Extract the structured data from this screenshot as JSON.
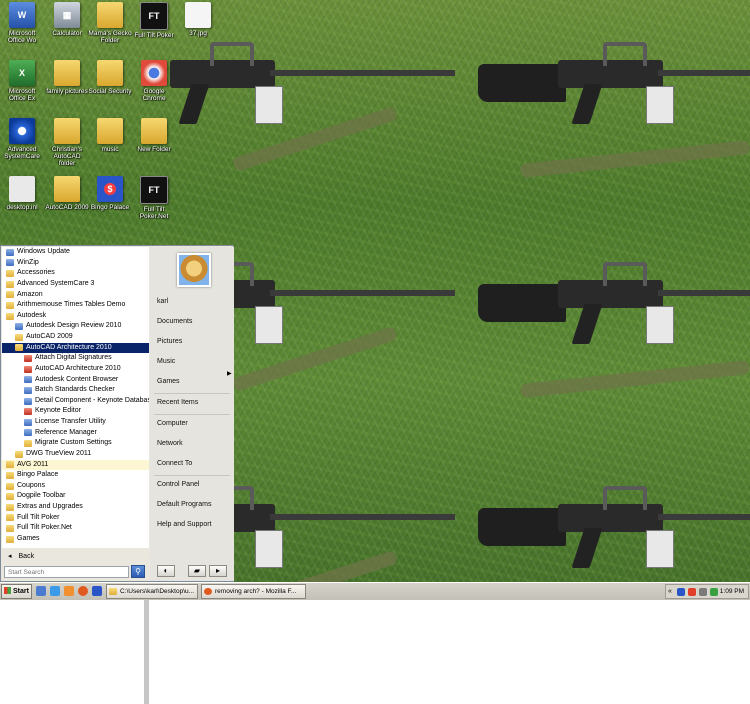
{
  "desktop": {
    "icons": [
      {
        "label": "Microsoft Office Wo",
        "glyph": "W",
        "kind": "word"
      },
      {
        "label": "Calculator",
        "glyph": "▦",
        "kind": "calc"
      },
      {
        "label": "Mama's Gecko Folder",
        "glyph": "",
        "kind": "folder"
      },
      {
        "label": "Full Tilt Poker",
        "glyph": "FT",
        "kind": "ft"
      },
      {
        "label": "37.jpg",
        "glyph": "",
        "kind": "white"
      },
      {
        "label": "Microsoft Office Ex",
        "glyph": "X",
        "kind": "excel"
      },
      {
        "label": "family pictures",
        "glyph": "",
        "kind": "folder"
      },
      {
        "label": "Social Security",
        "glyph": "",
        "kind": "folder"
      },
      {
        "label": "Google Chrome",
        "glyph": "",
        "kind": "chrome"
      },
      {
        "label": "Advanced SystemCare",
        "glyph": "C",
        "kind": "asc"
      },
      {
        "label": "Christian's AutoCAD folder",
        "glyph": "",
        "kind": "folder"
      },
      {
        "label": "music",
        "glyph": "",
        "kind": "folder"
      },
      {
        "label": "New Folder",
        "glyph": "",
        "kind": "folder"
      },
      {
        "label": "desktop.ini",
        "glyph": "",
        "kind": "ini"
      },
      {
        "label": "AutoCAD 2009",
        "glyph": "",
        "kind": "folder"
      },
      {
        "label": "Bingo Palace",
        "glyph": "$",
        "kind": "bingo"
      },
      {
        "label": "Full Tilt Poker.Net",
        "glyph": "FT",
        "kind": "ft"
      }
    ]
  },
  "start_menu": {
    "programs": [
      {
        "label": "Windows Update",
        "icon": "app",
        "indent": 0
      },
      {
        "label": "WinZip",
        "icon": "app",
        "indent": 0
      },
      {
        "label": "Accessories",
        "icon": "folder",
        "indent": 0
      },
      {
        "label": "Advanced SystemCare 3",
        "icon": "folder",
        "indent": 0
      },
      {
        "label": "Amazon",
        "icon": "folder",
        "indent": 0
      },
      {
        "label": "Arithmemouse Times Tables Demo",
        "icon": "folder",
        "indent": 0
      },
      {
        "label": "Autodesk",
        "icon": "folder",
        "indent": 0
      },
      {
        "label": "Autodesk Design Review 2010",
        "icon": "app",
        "indent": 1
      },
      {
        "label": "AutoCAD 2009",
        "icon": "folder",
        "indent": 1
      },
      {
        "label": "AutoCAD Architecture 2010",
        "icon": "folder",
        "indent": 1,
        "state": "selected"
      },
      {
        "label": "Attach Digital Signatures",
        "icon": "red",
        "indent": 2
      },
      {
        "label": "AutoCAD Architecture 2010",
        "icon": "red",
        "indent": 2
      },
      {
        "label": "Autodesk Content Browser",
        "icon": "app",
        "indent": 2
      },
      {
        "label": "Batch Standards Checker",
        "icon": "app",
        "indent": 2
      },
      {
        "label": "Detail Component - Keynote Database",
        "icon": "app",
        "indent": 2
      },
      {
        "label": "Keynote Editor",
        "icon": "red",
        "indent": 2
      },
      {
        "label": "License Transfer Utility",
        "icon": "app",
        "indent": 2
      },
      {
        "label": "Reference Manager",
        "icon": "app",
        "indent": 2
      },
      {
        "label": "Migrate Custom Settings",
        "icon": "folder",
        "indent": 2
      },
      {
        "label": "DWG TrueView 2011",
        "icon": "folder",
        "indent": 1
      },
      {
        "label": "AVG 2011",
        "icon": "folder",
        "indent": 0,
        "state": "highlight"
      },
      {
        "label": "Bingo Palace",
        "icon": "folder",
        "indent": 0
      },
      {
        "label": "Coupons",
        "icon": "folder",
        "indent": 0
      },
      {
        "label": "Dogpile Toolbar",
        "icon": "folder",
        "indent": 0
      },
      {
        "label": "Extras and Upgrades",
        "icon": "folder",
        "indent": 0
      },
      {
        "label": "Full Tilt Poker",
        "icon": "folder",
        "indent": 0
      },
      {
        "label": "Full Tilt Poker.Net",
        "icon": "folder",
        "indent": 0
      },
      {
        "label": "Games",
        "icon": "folder",
        "indent": 0
      }
    ],
    "back_label": "Back",
    "search_placeholder": "Start Search",
    "right_items": [
      {
        "label": "karl",
        "group": 1
      },
      {
        "label": "Documents",
        "group": 1
      },
      {
        "label": "Pictures",
        "group": 1
      },
      {
        "label": "Music",
        "group": 1
      },
      {
        "label": "Games",
        "group": 1
      },
      {
        "label": "Recent Items",
        "group": 2,
        "submenu": true
      },
      {
        "label": "Computer",
        "group": 3
      },
      {
        "label": "Network",
        "group": 3
      },
      {
        "label": "Connect To",
        "group": 3
      },
      {
        "label": "Control Panel",
        "group": 4
      },
      {
        "label": "Default Programs",
        "group": 4
      },
      {
        "label": "Help and Support",
        "group": 4
      }
    ]
  },
  "taskbar": {
    "start_label": "Start",
    "tasks": [
      {
        "label": "C:\\Users\\karl\\Desktop\\u..."
      },
      {
        "label": "removing arch? - Mozilla F..."
      }
    ],
    "clock": "1:09 PM",
    "tray_expand": "«"
  }
}
